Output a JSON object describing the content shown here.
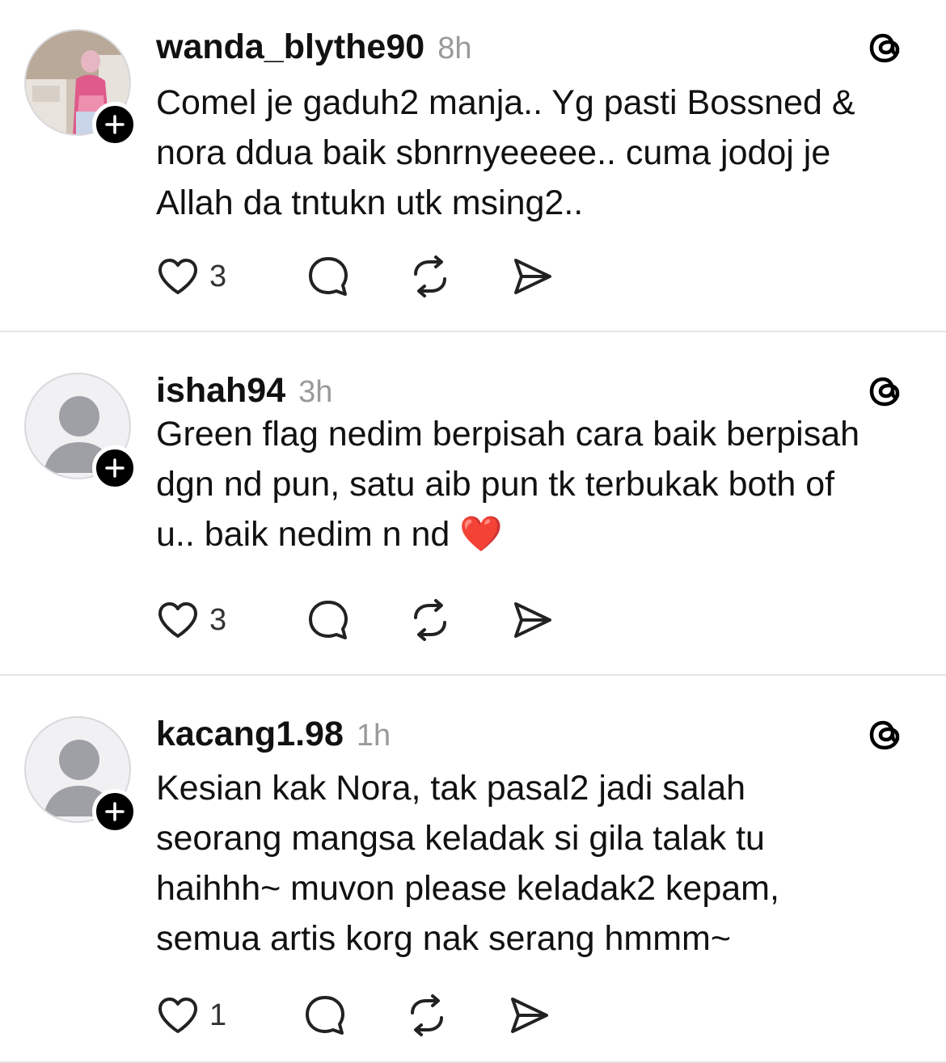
{
  "comments": [
    {
      "username": "wanda_blythe90",
      "time": "8h",
      "text": "Comel je gaduh2 manja.. Yg pasti Bossned &\nnora ddua baik sbnrnyeeeee.. cuma jodoj je\nAllah da tntukn utk msing2..",
      "likes": "3",
      "avatar": "photo-avatar"
    },
    {
      "username": "ishah94",
      "time": "3h",
      "text": "Green flag nedim berpisah cara baik berpisah\ndgn nd pun, satu aib pun tk terbukak both of\nu.. baik nedim n nd ❤️",
      "likes": "3",
      "avatar": "default-avatar"
    },
    {
      "username": "kacang1.98",
      "time": "1h",
      "text": "Kesian kak Nora, tak pasal2 jadi salah\nseorang mangsa keladak si gila talak tu\nhaihhh~ muvon please keladak2 kepam,\nsemua artis korg nak serang hmmm~",
      "likes": "1",
      "avatar": "default-avatar"
    }
  ],
  "icons": {
    "like": "heart-icon",
    "reply": "reply-icon",
    "repost": "repost-icon",
    "share": "share-icon",
    "brand": "threads-logo-icon",
    "follow": "plus-icon"
  },
  "colors": {
    "text": "#111111",
    "muted": "#9a9a9a",
    "divider": "#e4e4e4",
    "badge": "#000000"
  }
}
